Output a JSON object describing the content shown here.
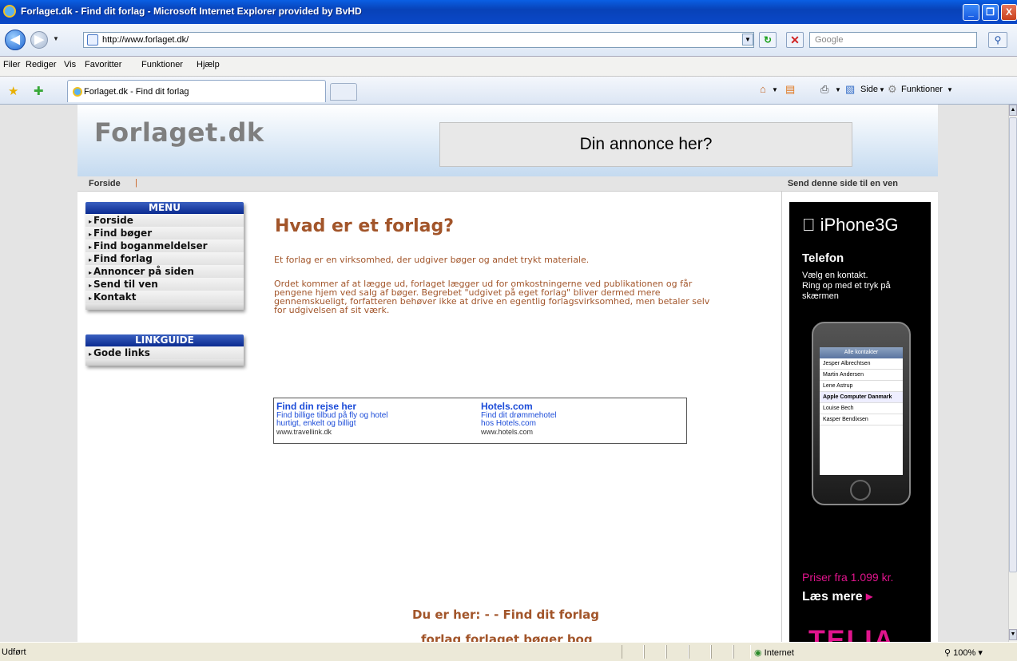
{
  "window": {
    "title": "Forlaget.dk - Find dit forlag - Microsoft Internet Explorer provided by BvHD",
    "minimize_glyph": "_",
    "maximize_glyph": "❐",
    "close_glyph": "X"
  },
  "addressbar": {
    "back_glyph": "◀",
    "forward_glyph": "▶",
    "url": "http://www.forlaget.dk/",
    "search_placeholder": "Google"
  },
  "menubar": {
    "items": [
      "Filer",
      "Rediger",
      "Vis",
      "Favoritter",
      "Funktioner",
      "Hjælp"
    ]
  },
  "tabs": {
    "active_label": "Forlaget.dk - Find dit forlag"
  },
  "commandbar": {
    "page_label": "Side",
    "tools_label": "Funktioner"
  },
  "site": {
    "logo": "Forlaget.dk",
    "ad_banner": "Din annonce her?",
    "subnav_left": "Forside",
    "subnav_sep": "|",
    "subnav_right": "Send denne side til en ven",
    "menu": {
      "title": "MENU",
      "items": [
        "Forside",
        "Find bøger",
        "Find boganmeldelser",
        "Find forlag",
        "Annoncer på siden",
        "Send til ven",
        "Kontakt"
      ]
    },
    "linkguide": {
      "title": "LINKGUIDE",
      "items": [
        "Gode links"
      ]
    },
    "heading": "Hvad er et forlag?",
    "para1": "Et forlag er en virksomhed, der udgiver bøger og andet trykt materiale.",
    "para2": [
      "Ordet kommer af at lægge ud, forlaget lægger ud for omkostningerne ved publikationen og får",
      "pengene hjem ved salg af bøger. Begrebet \"udgivet på eget forlag\" bliver dermed mere",
      "gennemskueligt, forfatteren behøver ikke at drive en egentlig forlagsvirksomhed, men betaler selv",
      "for udgivelsen af sit værk."
    ],
    "textlinks": [
      {
        "title": "Find din rejse her",
        "line1": "Find billige tilbud på fly og hotel",
        "line2": "hurtigt, enkelt og billigt",
        "url": "www.travellink.dk"
      },
      {
        "title": "Hotels.com",
        "line1": "Find dit drømmehotel",
        "line2": "hos Hotels.com",
        "url": "www.hotels.com"
      }
    ],
    "breadcrumb": "Du er her: - - Find dit forlag",
    "tags": "forlag forlaget bøger bog"
  },
  "iphone_ad": {
    "brand": "iPhone",
    "brand_suffix": "3G",
    "telefon": "Telefon",
    "text_lines": [
      "Vælg en kontakt.",
      "Ring op med et tryk på",
      "skærmen"
    ],
    "screen_title": "Alle kontakter",
    "contacts": [
      "Jesper Albrechtsen",
      "Martin Andersen",
      "Lene Astrup",
      "Apple Computer Danmark",
      "Louise Bech",
      "Kasper Bendixsen"
    ],
    "price": "Priser fra 1.099 kr.",
    "more": "Læs mere",
    "telia": "TELIA"
  },
  "statusbar": {
    "status": "Udført",
    "zone": "Internet",
    "zoom": "100%"
  }
}
